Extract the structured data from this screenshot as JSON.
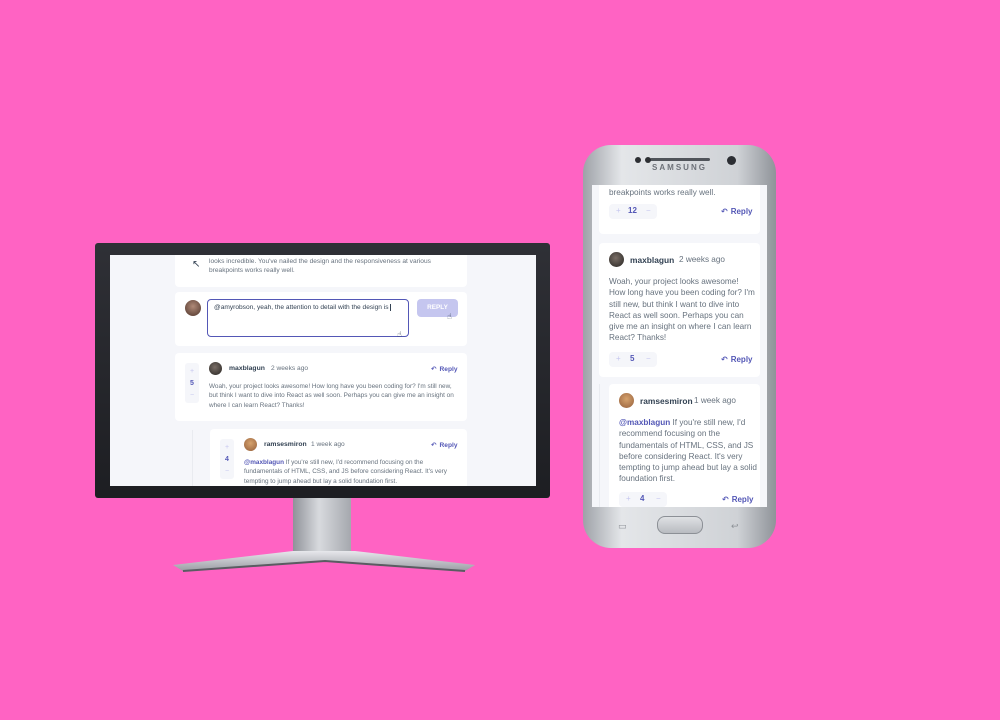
{
  "app": {
    "accent": "#5357b6",
    "background": "#ff63c3"
  },
  "desktop": {
    "top_comment_tail": "looks incredible. You've nailed the design and the responsiveness at various breakpoints works really well.",
    "reply_box": {
      "value": "@amyrobson, yeah, the attention to detail with the design is",
      "button_label": "REPLY"
    },
    "comment_max": {
      "username": "maxblagun",
      "date": "2 weeks ago",
      "reply_label": "Reply",
      "score": "5",
      "text": "Woah, your project looks awesome! How long have you been coding for? I'm still new, but think I want to dive into React as well soon. Perhaps you can give me an insight on where I can learn React? Thanks!"
    },
    "comment_ramses": {
      "username": "ramsesmiron",
      "date": "1 week ago",
      "reply_label": "Reply",
      "score": "4",
      "mention": "@maxblagun",
      "text": " If you're still new, I'd recommend focusing on the fundamentals of HTML, CSS, and JS before considering React. It's very tempting to jump ahead but lay a solid foundation first."
    },
    "vote_plus": "+",
    "vote_minus": "−",
    "reply_icon": "reply-arrow-icon"
  },
  "mobile": {
    "brand": "SAMSUNG",
    "top_comment_tail": "breakpoints works really well.",
    "top_score": "12",
    "top_reply_label": "Reply",
    "comment_max": {
      "username": "maxblagun",
      "date": "2 weeks ago",
      "text": "Woah, your project looks awesome! How long have you been coding for? I'm still new, but think I want to dive into React as well soon. Perhaps you can give me an insight on where I can learn React? Thanks!",
      "score": "5",
      "reply_label": "Reply"
    },
    "comment_ramses": {
      "username": "ramsesmiron",
      "date": "1 week ago",
      "mention": "@maxblagun",
      "text": " If you're still new, I'd recommend focusing on the fundamentals of HTML, CSS, and JS before considering React. It's very tempting to jump ahead but lay a solid foundation first.",
      "score": "4",
      "reply_label": "Reply"
    },
    "vote_plus": "+",
    "vote_minus": "−"
  }
}
